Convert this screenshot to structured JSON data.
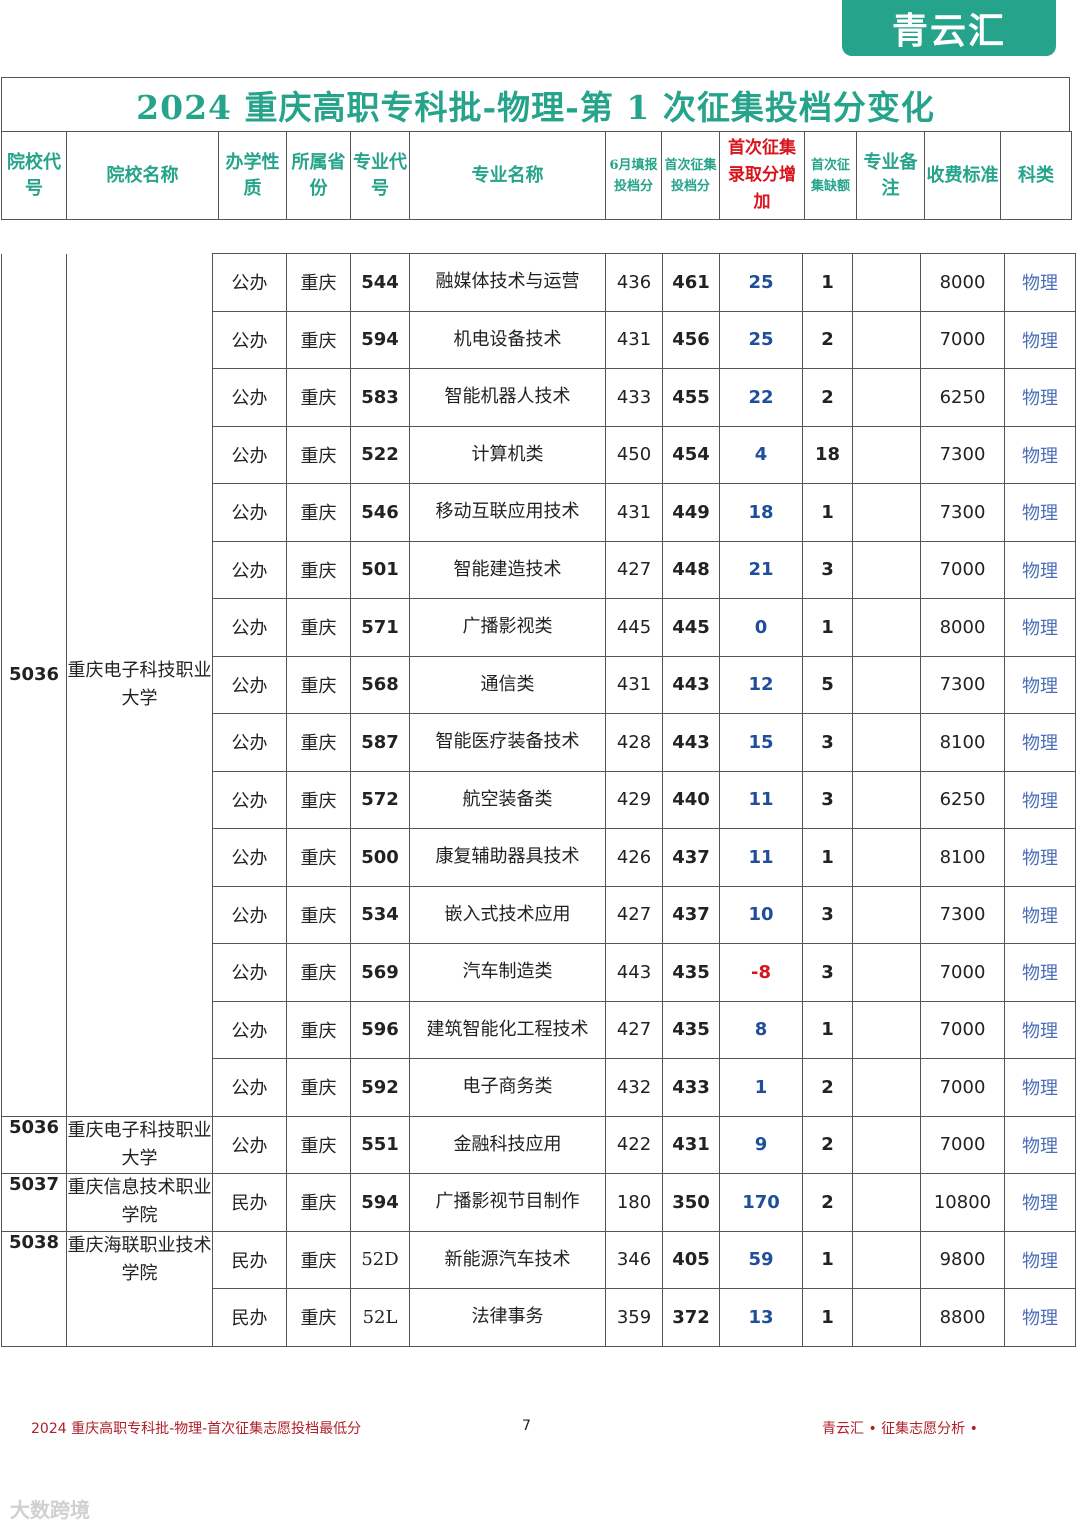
{
  "brand": {
    "logo_text": "青云汇"
  },
  "title": "2024 重庆高职专科批-物理-第 1 次征集投档分变化",
  "headers": {
    "school_code": "院校代号",
    "school_name": "院校名称",
    "nature": "办学性质",
    "province": "所属省份",
    "major_code": "专业代号",
    "major_name": "专业名称",
    "june_score": "6月填报投档分",
    "first_score": "首次征集投档分",
    "increase": "首次征集录取分增加",
    "vacancy": "首次征集缺额",
    "remark": "专业备注",
    "fee": "收费标准",
    "subject": "科类"
  },
  "groups": [
    {
      "code": "5036",
      "name": "重庆电子科技职业大学",
      "rows": [
        {
          "nature": "公办",
          "province": "重庆",
          "major_code": "544",
          "major": "融媒体技术与运营",
          "june": "436",
          "first": "461",
          "inc": "25",
          "vac": "1",
          "remark": "",
          "fee": "8000",
          "subject": "物理"
        },
        {
          "nature": "公办",
          "province": "重庆",
          "major_code": "594",
          "major": "机电设备技术",
          "june": "431",
          "first": "456",
          "inc": "25",
          "vac": "2",
          "remark": "",
          "fee": "7000",
          "subject": "物理"
        },
        {
          "nature": "公办",
          "province": "重庆",
          "major_code": "583",
          "major": "智能机器人技术",
          "june": "433",
          "first": "455",
          "inc": "22",
          "vac": "2",
          "remark": "",
          "fee": "6250",
          "subject": "物理"
        },
        {
          "nature": "公办",
          "province": "重庆",
          "major_code": "522",
          "major": "计算机类",
          "june": "450",
          "first": "454",
          "inc": "4",
          "vac": "18",
          "remark": "",
          "fee": "7300",
          "subject": "物理"
        },
        {
          "nature": "公办",
          "province": "重庆",
          "major_code": "546",
          "major": "移动互联应用技术",
          "june": "431",
          "first": "449",
          "inc": "18",
          "vac": "1",
          "remark": "",
          "fee": "7300",
          "subject": "物理"
        },
        {
          "nature": "公办",
          "province": "重庆",
          "major_code": "501",
          "major": "智能建造技术",
          "june": "427",
          "first": "448",
          "inc": "21",
          "vac": "3",
          "remark": "",
          "fee": "7000",
          "subject": "物理"
        },
        {
          "nature": "公办",
          "province": "重庆",
          "major_code": "571",
          "major": "广播影视类",
          "june": "445",
          "first": "445",
          "inc": "0",
          "vac": "1",
          "remark": "",
          "fee": "8000",
          "subject": "物理"
        },
        {
          "nature": "公办",
          "province": "重庆",
          "major_code": "568",
          "major": "通信类",
          "june": "431",
          "first": "443",
          "inc": "12",
          "vac": "5",
          "remark": "",
          "fee": "7300",
          "subject": "物理"
        },
        {
          "nature": "公办",
          "province": "重庆",
          "major_code": "587",
          "major": "智能医疗装备技术",
          "june": "428",
          "first": "443",
          "inc": "15",
          "vac": "3",
          "remark": "",
          "fee": "8100",
          "subject": "物理"
        },
        {
          "nature": "公办",
          "province": "重庆",
          "major_code": "572",
          "major": "航空装备类",
          "june": "429",
          "first": "440",
          "inc": "11",
          "vac": "3",
          "remark": "",
          "fee": "6250",
          "subject": "物理"
        },
        {
          "nature": "公办",
          "province": "重庆",
          "major_code": "500",
          "major": "康复辅助器具技术",
          "june": "426",
          "first": "437",
          "inc": "11",
          "vac": "1",
          "remark": "",
          "fee": "8100",
          "subject": "物理"
        },
        {
          "nature": "公办",
          "province": "重庆",
          "major_code": "534",
          "major": "嵌入式技术应用",
          "june": "427",
          "first": "437",
          "inc": "10",
          "vac": "3",
          "remark": "",
          "fee": "7300",
          "subject": "物理"
        },
        {
          "nature": "公办",
          "province": "重庆",
          "major_code": "569",
          "major": "汽车制造类",
          "june": "443",
          "first": "435",
          "inc": "-8",
          "vac": "3",
          "remark": "",
          "fee": "7000",
          "subject": "物理"
        },
        {
          "nature": "公办",
          "province": "重庆",
          "major_code": "596",
          "major": "建筑智能化工程技术",
          "june": "427",
          "first": "435",
          "inc": "8",
          "vac": "1",
          "remark": "",
          "fee": "7000",
          "subject": "物理"
        },
        {
          "nature": "公办",
          "province": "重庆",
          "major_code": "592",
          "major": "电子商务类",
          "june": "432",
          "first": "433",
          "inc": "1",
          "vac": "2",
          "remark": "",
          "fee": "7000",
          "subject": "物理"
        }
      ]
    },
    {
      "code": "5036",
      "name": "重庆电子科技职业大学",
      "rows": [
        {
          "nature": "公办",
          "province": "重庆",
          "major_code": "551",
          "major": "金融科技应用",
          "june": "422",
          "first": "431",
          "inc": "9",
          "vac": "2",
          "remark": "",
          "fee": "7000",
          "subject": "物理"
        }
      ]
    },
    {
      "code": "5037",
      "name": "重庆信息技术职业学院",
      "rows": [
        {
          "nature": "民办",
          "province": "重庆",
          "major_code": "594",
          "major": "广播影视节目制作",
          "june": "180",
          "first": "350",
          "inc": "170",
          "vac": "2",
          "remark": "",
          "fee": "10800",
          "subject": "物理"
        }
      ]
    },
    {
      "code": "5038",
      "name": "重庆海联职业技术学院",
      "rows": [
        {
          "nature": "民办",
          "province": "重庆",
          "major_code": "52D",
          "major": "新能源汽车技术",
          "june": "346",
          "first": "405",
          "inc": "59",
          "vac": "1",
          "remark": "",
          "fee": "9800",
          "subject": "物理"
        },
        {
          "nature": "民办",
          "province": "重庆",
          "major_code": "52L",
          "major": "法律事务",
          "june": "359",
          "first": "372",
          "inc": "13",
          "vac": "1",
          "remark": "",
          "fee": "8800",
          "subject": "物理"
        }
      ]
    }
  ],
  "footer": {
    "left": "2024 重庆高职专科批-物理-首次征集志愿投档最低分",
    "page": "7",
    "right": "青云汇 • 征集志愿分析 •"
  },
  "watermark": "大数跨境"
}
